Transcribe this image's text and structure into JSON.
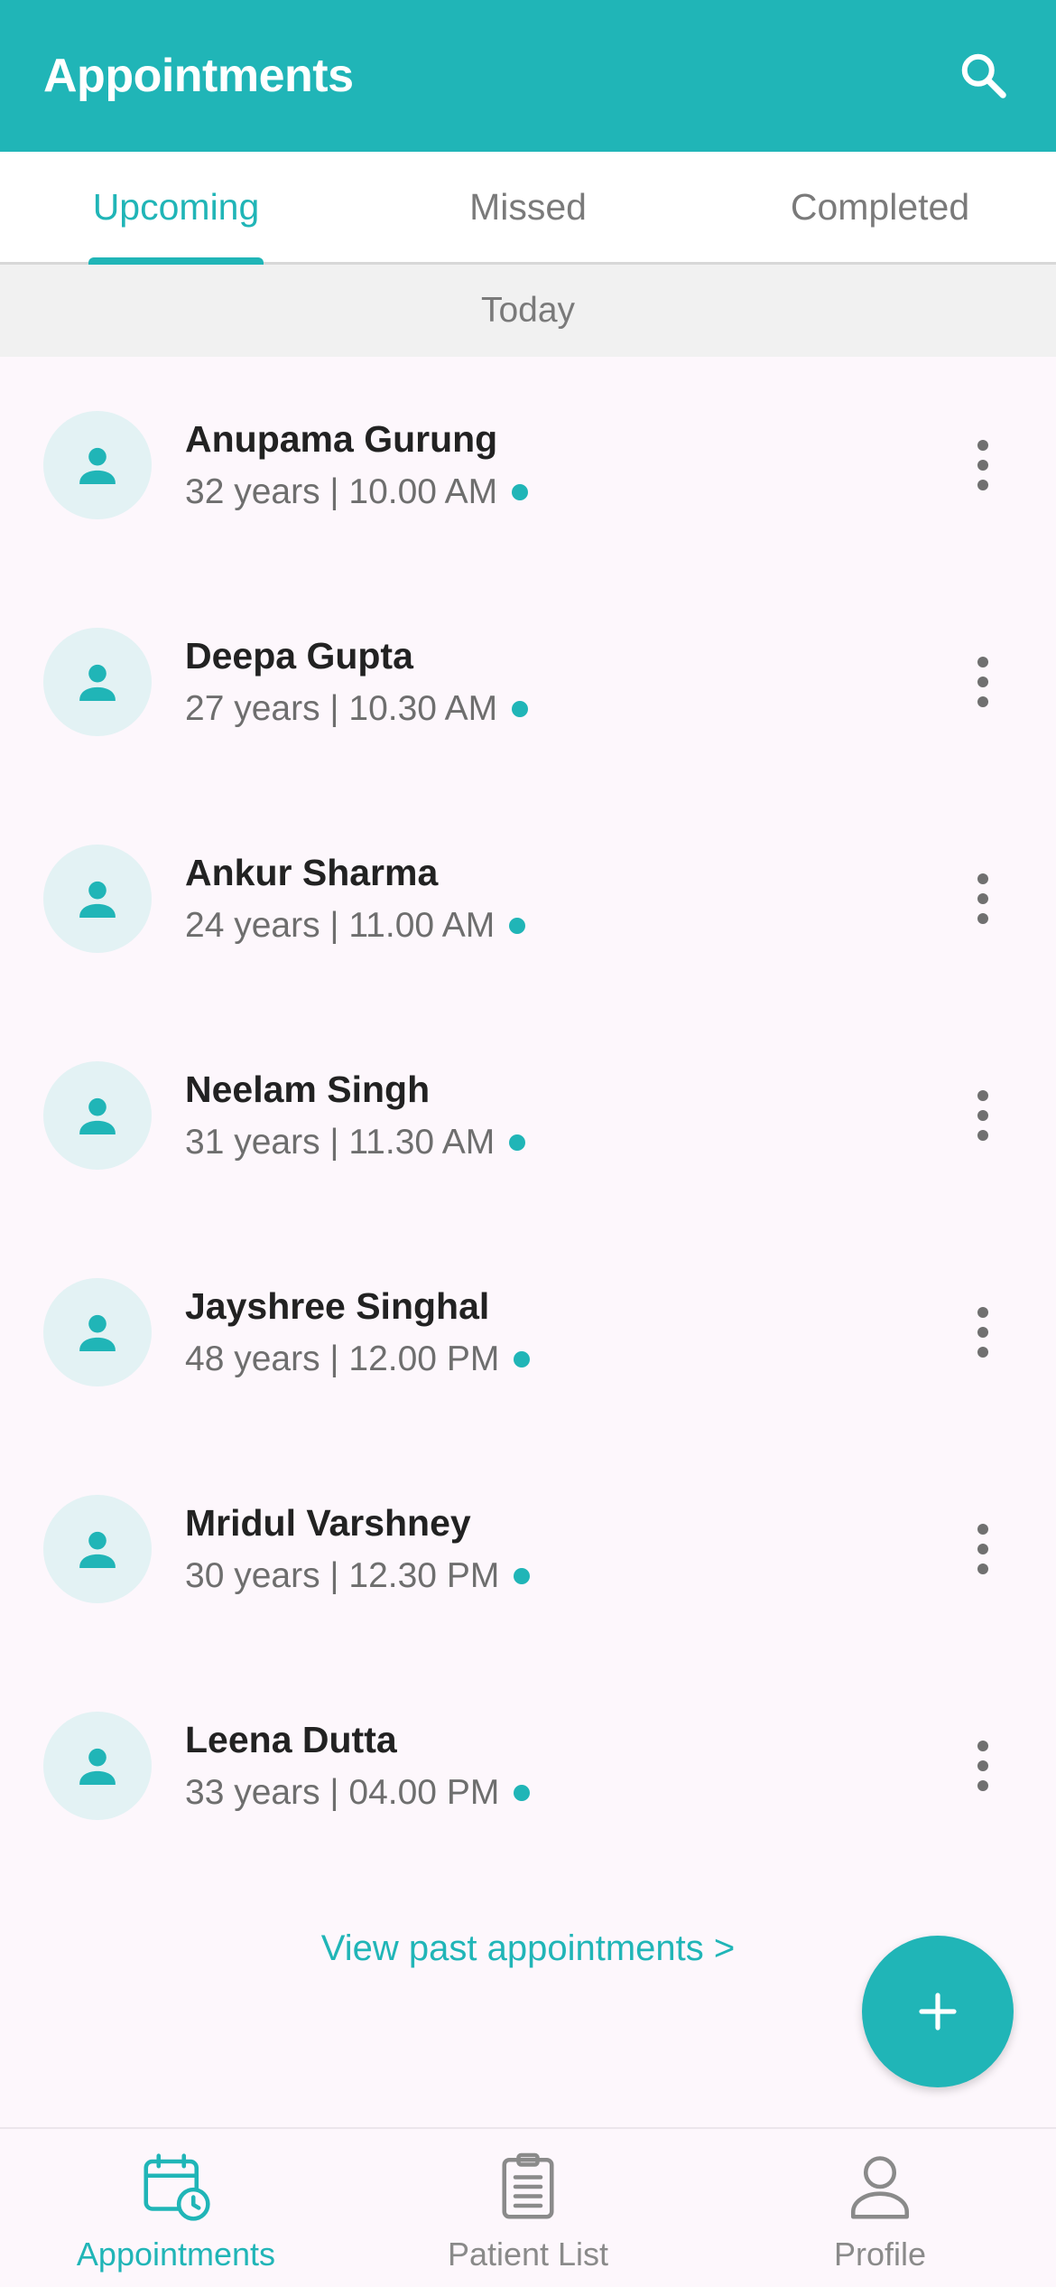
{
  "header": {
    "title": "Appointments"
  },
  "tabs": [
    {
      "label": "Upcoming",
      "active": true
    },
    {
      "label": "Missed",
      "active": false
    },
    {
      "label": "Completed",
      "active": false
    }
  ],
  "section": {
    "label": "Today"
  },
  "appointments": [
    {
      "name": "Anupama Gurung",
      "meta": "32 years | 10.00 AM"
    },
    {
      "name": "Deepa Gupta",
      "meta": "27 years | 10.30 AM"
    },
    {
      "name": "Ankur Sharma",
      "meta": "24 years | 11.00 AM"
    },
    {
      "name": "Neelam Singh",
      "meta": "31 years | 11.30 AM"
    },
    {
      "name": "Jayshree Singhal",
      "meta": "48 years | 12.00 PM"
    },
    {
      "name": "Mridul Varshney",
      "meta": "30 years | 12.30 PM"
    },
    {
      "name": "Leena Dutta",
      "meta": "33 years | 04.00 PM"
    }
  ],
  "view_past": {
    "label": "View past appointments >"
  },
  "bottom_nav": [
    {
      "label": "Appointments",
      "icon": "calendar-clock-icon",
      "active": true
    },
    {
      "label": "Patient List",
      "icon": "clipboard-icon",
      "active": false
    },
    {
      "label": "Profile",
      "icon": "person-outline-icon",
      "active": false
    }
  ],
  "colors": {
    "accent": "#20B5B7",
    "background": "#FDF7FC",
    "avatar_bg": "#E3F2F4",
    "section_bg": "#F1F1F1"
  }
}
